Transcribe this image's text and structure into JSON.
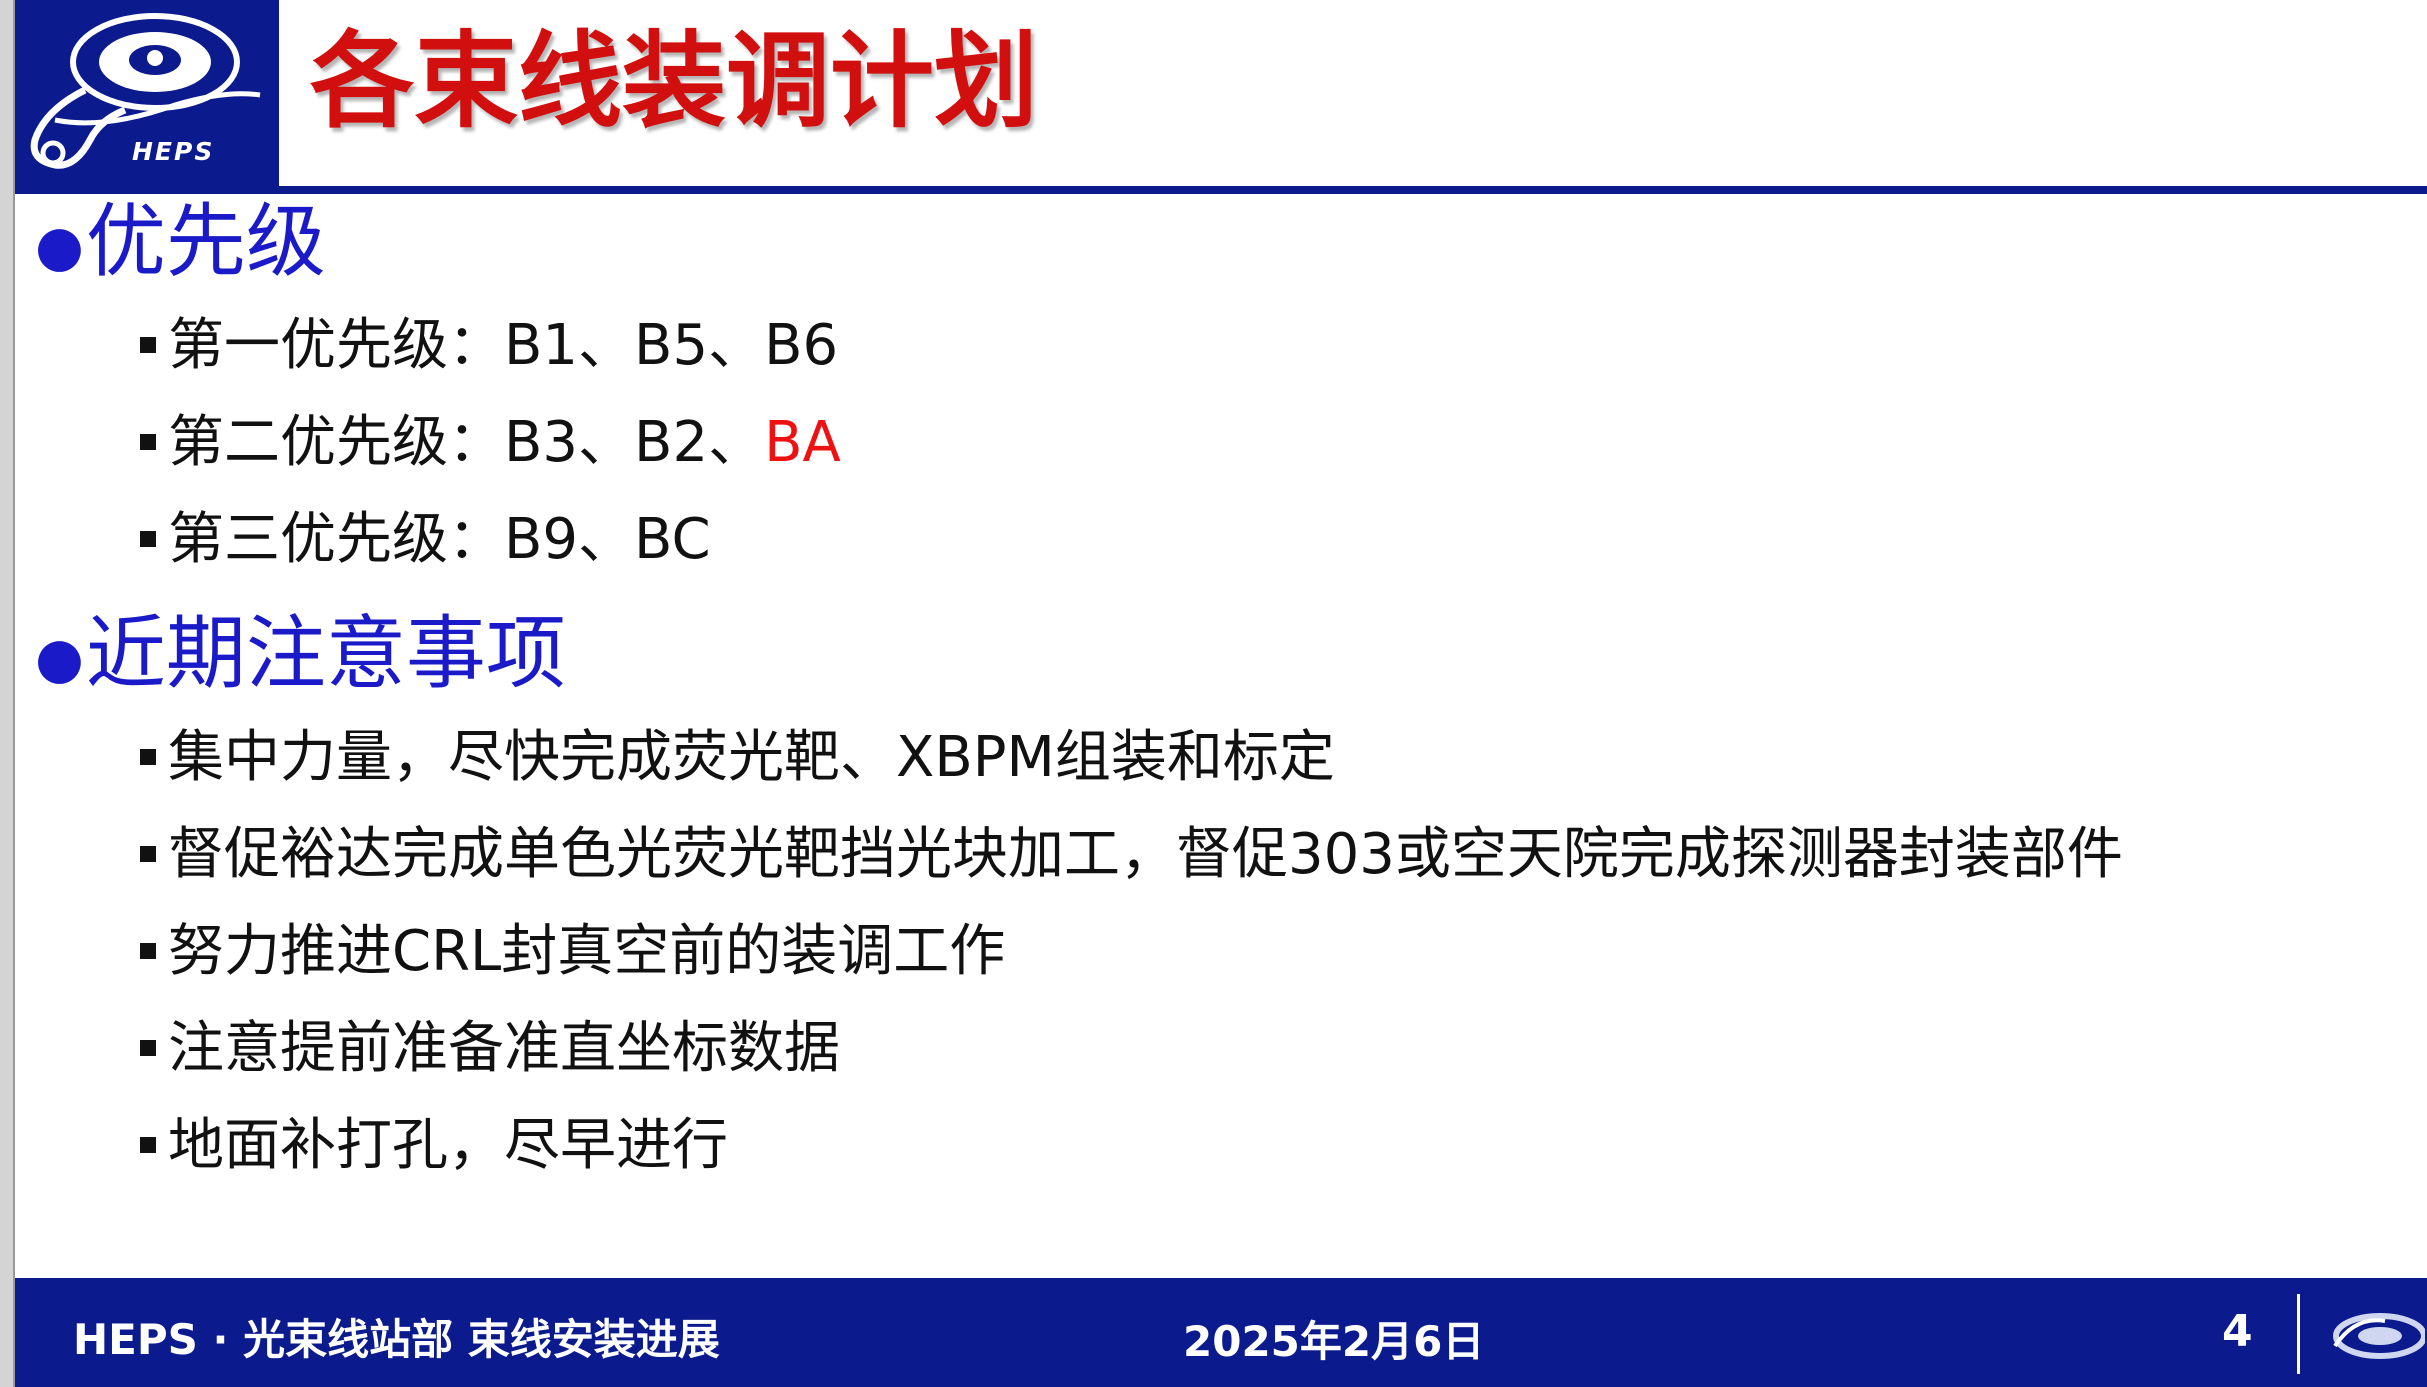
{
  "header": {
    "title": "各束线装调计划",
    "logo_text": "HEPS"
  },
  "sections": [
    {
      "heading": "优先级",
      "items": [
        {
          "text": "第一优先级：B1、B5、B6",
          "highlight": ""
        },
        {
          "text": "第二优先级：B3、B2、",
          "highlight": "BA"
        },
        {
          "text": "第三优先级：B9、BC",
          "highlight": ""
        }
      ]
    },
    {
      "heading": "近期注意事项",
      "items": [
        {
          "text": "集中力量，尽快完成荧光靶、XBPM组装和标定",
          "highlight": ""
        },
        {
          "text": "督促裕达完成单色光荧光靶挡光块加工，督促303或空天院完成探测器封装部件",
          "highlight": ""
        },
        {
          "text": "努力推进CRL封真空前的装调工作",
          "highlight": ""
        },
        {
          "text": "注意提前准备准直坐标数据",
          "highlight": ""
        },
        {
          "text": "地面补打孔，尽早进行",
          "highlight": ""
        }
      ]
    }
  ],
  "footer": {
    "left": "HEPS · 光束线站部 束线安装进展",
    "date": "2025年2月6日",
    "page": "4"
  },
  "colors": {
    "brand_blue": "#0b1a8c",
    "title_red": "#d20f0f",
    "heading_blue": "#1a1ac8",
    "highlight_red": "#ee1111"
  }
}
